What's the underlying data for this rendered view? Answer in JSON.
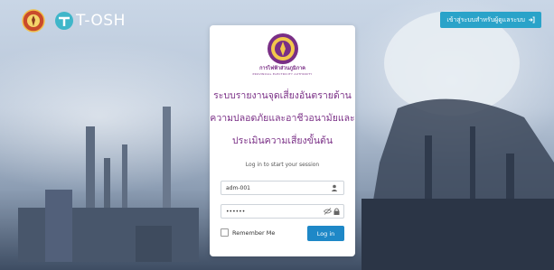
{
  "header": {
    "app_name": "T-OSH",
    "officer_button_label": "เข้าสู่ระบบสำหรับผู้ดูแลระบบ"
  },
  "card": {
    "org_name_th": "การไฟฟ้าส่วนภูมิภาค",
    "org_name_en": "PROVINCIAL ELECTRICITY AUTHORITY",
    "title_lines": [
      "ระบบรายงานจุดเสี่ยงอันตรายด้าน",
      "ความปลอดภัยและอาชีวอนามัยและ",
      "ประเมินความเสี่ยงขั้นต้น"
    ],
    "session_message": "Log in to start your session",
    "username_value": "adm-001",
    "password_value": "••••••",
    "remember_label": "Remember Me",
    "login_label": "Log in"
  },
  "colors": {
    "accent": "#1e88c7",
    "brand": "#7a2f86",
    "officer_button": "#2aa3c9"
  },
  "icons": {
    "username": "user-icon",
    "password_toggle": "eye-slash-icon",
    "password": "lock-icon",
    "officer": "sign-in-icon"
  }
}
